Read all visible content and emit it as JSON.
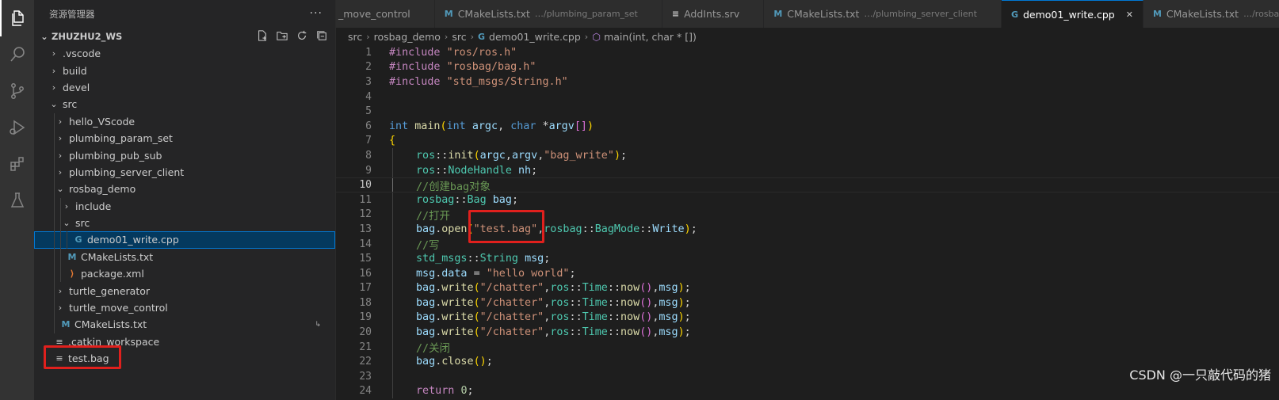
{
  "activity_bar": {
    "items": [
      {
        "icon": "files-icon",
        "active": true
      },
      {
        "icon": "search-icon"
      },
      {
        "icon": "source-control-icon"
      },
      {
        "icon": "run-debug-icon"
      },
      {
        "icon": "extensions-icon"
      },
      {
        "icon": "testing-icon"
      }
    ]
  },
  "sidebar": {
    "title": "资源管理器",
    "more": "···",
    "workspace": "ZHUZHU2_WS",
    "tree": [
      {
        "label": ".vscode",
        "type": "folder",
        "expanded": false,
        "depth": 0
      },
      {
        "label": "build",
        "type": "folder",
        "expanded": false,
        "depth": 0
      },
      {
        "label": "devel",
        "type": "folder",
        "expanded": false,
        "depth": 0
      },
      {
        "label": "src",
        "type": "folder",
        "expanded": true,
        "depth": 0
      },
      {
        "label": "hello_VScode",
        "type": "folder",
        "expanded": false,
        "depth": 1
      },
      {
        "label": "plumbing_param_set",
        "type": "folder",
        "expanded": false,
        "depth": 1
      },
      {
        "label": "plumbing_pub_sub",
        "type": "folder",
        "expanded": false,
        "depth": 1
      },
      {
        "label": "plumbing_server_client",
        "type": "folder",
        "expanded": false,
        "depth": 1
      },
      {
        "label": "rosbag_demo",
        "type": "folder",
        "expanded": true,
        "depth": 1
      },
      {
        "label": "include",
        "type": "folder",
        "expanded": false,
        "depth": 2
      },
      {
        "label": "src",
        "type": "folder",
        "expanded": true,
        "depth": 2
      },
      {
        "label": "demo01_write.cpp",
        "type": "cpp",
        "depth": 3,
        "selected": true
      },
      {
        "label": "CMakeLists.txt",
        "type": "cmake",
        "depth": 2
      },
      {
        "label": "package.xml",
        "type": "xml",
        "depth": 2
      },
      {
        "label": "turtle_generator",
        "type": "folder",
        "expanded": false,
        "depth": 1
      },
      {
        "label": "turtle_move_control",
        "type": "folder",
        "expanded": false,
        "depth": 1
      },
      {
        "label": "CMakeLists.txt",
        "type": "cmake",
        "depth": 1,
        "badge": "↳"
      },
      {
        "label": ".catkin_workspace",
        "type": "text",
        "depth": 0
      },
      {
        "label": "test.bag",
        "type": "text",
        "depth": 0,
        "highlighted": true
      }
    ]
  },
  "tabs": [
    {
      "label": "_move_control",
      "desc": "",
      "icon": ""
    },
    {
      "label": "CMakeLists.txt",
      "desc": "…/plumbing_param_set",
      "icon": "M"
    },
    {
      "label": "AddInts.srv",
      "desc": "",
      "icon": "≡"
    },
    {
      "label": "CMakeLists.txt",
      "desc": "…/plumbing_server_client",
      "icon": "M"
    },
    {
      "label": "demo01_write.cpp",
      "desc": "",
      "icon": "G",
      "active": true
    },
    {
      "label": "CMakeLists.txt",
      "desc": "…/rosbag_de",
      "icon": "M"
    }
  ],
  "breadcrumb": [
    "src",
    "rosbag_demo",
    "src",
    "demo01_write.cpp",
    "main(int, char * [])"
  ],
  "editor": {
    "current_line": 10,
    "lines": [
      {
        "n": "1",
        "text": "#include \"ros/ros.h\""
      },
      {
        "n": "2",
        "text": "#include \"rosbag/bag.h\""
      },
      {
        "n": "3",
        "text": "#include \"std_msgs/String.h\""
      },
      {
        "n": "4",
        "text": ""
      },
      {
        "n": "5",
        "text": ""
      },
      {
        "n": "6",
        "text": "int main(int argc, char *argv[])"
      },
      {
        "n": "7",
        "text": "{"
      },
      {
        "n": "8",
        "text": "ros::init(argc,argv,\"bag_write\");"
      },
      {
        "n": "9",
        "text": "ros::NodeHandle nh;"
      },
      {
        "n": "10",
        "text": "//创建bag对象"
      },
      {
        "n": "11",
        "text": "rosbag::Bag bag;"
      },
      {
        "n": "12",
        "text": "//打开"
      },
      {
        "n": "13",
        "text": "bag.open(\"test.bag\",rosbag::BagMode::Write);"
      },
      {
        "n": "14",
        "text": "//写"
      },
      {
        "n": "15",
        "text": "std_msgs::String msg;"
      },
      {
        "n": "16",
        "text": "msg.data = \"hello world\";"
      },
      {
        "n": "17",
        "text": "bag.write(\"/chatter\",ros::Time::now(),msg);"
      },
      {
        "n": "18",
        "text": "bag.write(\"/chatter\",ros::Time::now(),msg);"
      },
      {
        "n": "19",
        "text": "bag.write(\"/chatter\",ros::Time::now(),msg);"
      },
      {
        "n": "20",
        "text": "bag.write(\"/chatter\",ros::Time::now(),msg);"
      },
      {
        "n": "21",
        "text": "//关闭"
      },
      {
        "n": "22",
        "text": "bag.close();"
      },
      {
        "n": "23",
        "text": ""
      },
      {
        "n": "24",
        "text": "return 0;"
      }
    ]
  },
  "watermark": "CSDN @一只敲代码的猪",
  "colors": {
    "annotation_red": "#e0201d",
    "selection": "#04395e",
    "accent": "#0078d4"
  }
}
